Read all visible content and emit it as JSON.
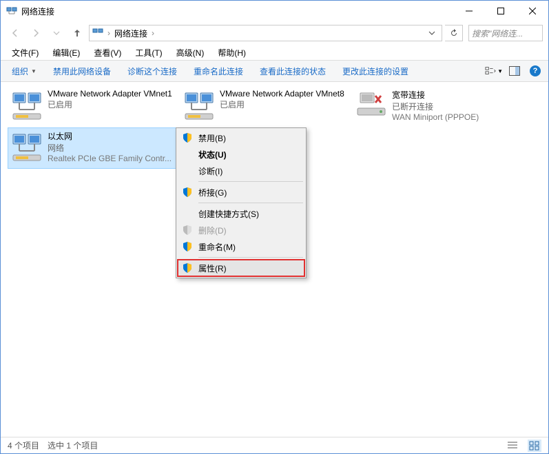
{
  "window": {
    "title": "网络连接"
  },
  "address": {
    "crumb": "网络连接",
    "search_placeholder": "搜索\"网络连..."
  },
  "menu": {
    "file": "文件(F)",
    "edit": "编辑(E)",
    "view": "查看(V)",
    "tools": "工具(T)",
    "advanced": "高级(N)",
    "help": "帮助(H)"
  },
  "toolbar": {
    "organize": "组织",
    "disable": "禁用此网络设备",
    "diagnose": "诊断这个连接",
    "rename": "重命名此连接",
    "status": "查看此连接的状态",
    "settings": "更改此连接的设置"
  },
  "adapters": [
    {
      "name": "VMware Network Adapter VMnet1",
      "status": "已启用",
      "device": ""
    },
    {
      "name": "VMware Network Adapter VMnet8",
      "status": "已启用",
      "device": ""
    },
    {
      "name": "宽带连接",
      "status": "已断开连接",
      "device": "WAN Miniport (PPPOE)"
    },
    {
      "name": "以太网",
      "status": "网络",
      "device": "Realtek PCIe GBE Family Contr..."
    }
  ],
  "context_menu": {
    "disable": "禁用(B)",
    "status": "状态(U)",
    "diagnose": "诊断(I)",
    "bridge": "桥接(G)",
    "shortcut": "创建快捷方式(S)",
    "delete": "删除(D)",
    "rename": "重命名(M)",
    "properties": "属性(R)"
  },
  "statusbar": {
    "count": "4 个项目",
    "selected": "选中 1 个项目"
  }
}
